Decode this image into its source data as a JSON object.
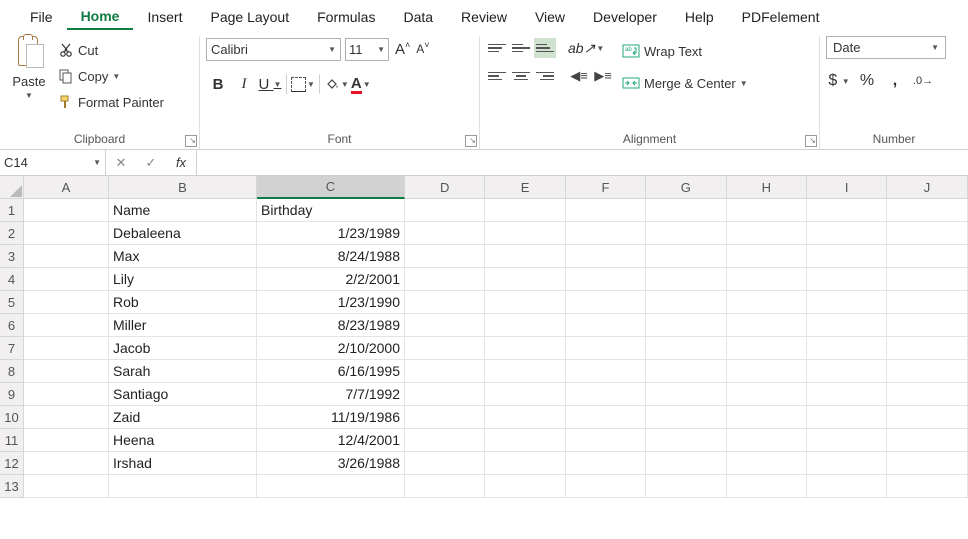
{
  "tabs": [
    "File",
    "Home",
    "Insert",
    "Page Layout",
    "Formulas",
    "Data",
    "Review",
    "View",
    "Developer",
    "Help",
    "PDFelement"
  ],
  "active_tab": "Home",
  "clipboard": {
    "paste": "Paste",
    "cut": "Cut",
    "copy": "Copy",
    "format_painter": "Format Painter",
    "label": "Clipboard"
  },
  "font": {
    "name": "Calibri",
    "size": "11",
    "bold": "B",
    "italic": "I",
    "underline": "U",
    "label": "Font"
  },
  "align": {
    "wrap": "Wrap Text",
    "merge": "Merge & Center",
    "label": "Alignment"
  },
  "number": {
    "format": "Date",
    "label": "Number"
  },
  "namebox": "C14",
  "columns": [
    "A",
    "B",
    "C",
    "D",
    "E",
    "F",
    "G",
    "H",
    "I",
    "J"
  ],
  "sel_col": "C",
  "rows": [
    {
      "n": "1",
      "B": "Name",
      "C": "Birthday",
      "cr": false
    },
    {
      "n": "2",
      "B": "Debaleena",
      "C": "1/23/1989",
      "cr": true
    },
    {
      "n": "3",
      "B": "Max",
      "C": "8/24/1988",
      "cr": true
    },
    {
      "n": "4",
      "B": "Lily",
      "C": "2/2/2001",
      "cr": true
    },
    {
      "n": "5",
      "B": "Rob",
      "C": "1/23/1990",
      "cr": true
    },
    {
      "n": "6",
      "B": "Miller",
      "C": "8/23/1989",
      "cr": true
    },
    {
      "n": "7",
      "B": "Jacob",
      "C": "2/10/2000",
      "cr": true
    },
    {
      "n": "8",
      "B": "Sarah",
      "C": "6/16/1995",
      "cr": true
    },
    {
      "n": "9",
      "B": "Santiago",
      "C": "7/7/1992",
      "cr": true
    },
    {
      "n": "10",
      "B": "Zaid",
      "C": "11/19/1986",
      "cr": true
    },
    {
      "n": "11",
      "B": "Heena",
      "C": "12/4/2001",
      "cr": true
    },
    {
      "n": "12",
      "B": "Irshad",
      "C": "3/26/1988",
      "cr": true
    },
    {
      "n": "13",
      "B": "",
      "C": "",
      "cr": false
    }
  ],
  "sel_row": "14"
}
